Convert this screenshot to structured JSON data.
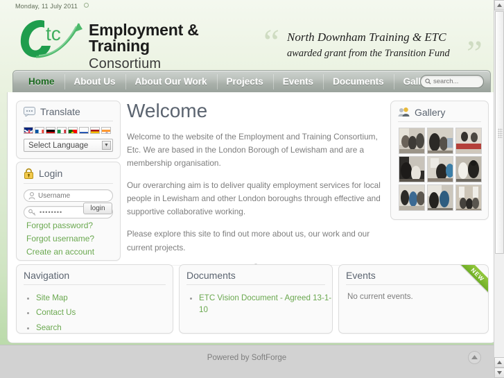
{
  "header": {
    "date": "Monday, 11 July 2011",
    "logo_primary": "Employment & Training",
    "logo_secondary": "Consortium",
    "logo_mark_letters": "etc",
    "quote_line1": "North Downham Training & ETC",
    "quote_line2": "awarded grant from the Transition Fund"
  },
  "nav": {
    "items": [
      {
        "label": "Home",
        "active": true
      },
      {
        "label": "About Us",
        "active": false
      },
      {
        "label": "About Our Work",
        "active": false
      },
      {
        "label": "Projects",
        "active": false
      },
      {
        "label": "Events",
        "active": false
      },
      {
        "label": "Documents",
        "active": false
      },
      {
        "label": "Gallery",
        "active": false
      }
    ],
    "search_placeholder": "search...",
    "search_value": ""
  },
  "translate": {
    "title": "Translate",
    "icon": "speech-bubble-icon",
    "languages": [
      {
        "name": "English",
        "code": "gb"
      },
      {
        "name": "French",
        "code": "fr"
      },
      {
        "name": "German",
        "code": "de"
      },
      {
        "name": "Italian",
        "code": "it"
      },
      {
        "name": "Portuguese",
        "code": "pt"
      },
      {
        "name": "Russian",
        "code": "ru"
      },
      {
        "name": "Spanish",
        "code": "es"
      },
      {
        "name": "Hindi",
        "code": "in"
      }
    ],
    "select_label": "Select Language"
  },
  "login": {
    "title": "Login",
    "icon": "lock-icon",
    "username_placeholder": "Username",
    "username_value": "",
    "password_value": "••••••••",
    "button_label": "login",
    "links": [
      "Forgot password?",
      "Forgot username?",
      "Create an account"
    ]
  },
  "main": {
    "heading": "Welcome",
    "paragraphs": [
      "Welcome to the website of the Employment and Training Consortium, Etc. We are based in the London Borough of Lewisham and are a membership organisation.",
      "Our overarching aim is to deliver quality employment services for local people in Lewisham and other London boroughs through effective and supportive collaborative working.",
      "Please explore this site to find out more about us, our work and our current projects."
    ]
  },
  "gallery": {
    "title": "Gallery",
    "icon": "people-icon",
    "thumbnails": [
      "photo-1",
      "photo-2",
      "photo-3",
      "photo-4",
      "photo-5",
      "photo-6",
      "photo-7",
      "photo-8",
      "photo-9"
    ]
  },
  "navigation_module": {
    "title": "Navigation",
    "items": [
      "Site Map",
      "Contact Us",
      "Search"
    ]
  },
  "documents_module": {
    "title": "Documents",
    "items": [
      "ETC Vision Document - Agreed 13-1-10"
    ]
  },
  "events_module": {
    "title": "Events",
    "badge": "NEW",
    "empty_text": "No current events."
  },
  "footer": {
    "text": "Powered by SoftForge",
    "to_top_icon": "arrow-up-icon"
  },
  "colors": {
    "link_green": "#6aa84f",
    "active_nav": "#1c6a20",
    "heading_slate": "#5b6470",
    "badge_green": "#8bc43c"
  }
}
